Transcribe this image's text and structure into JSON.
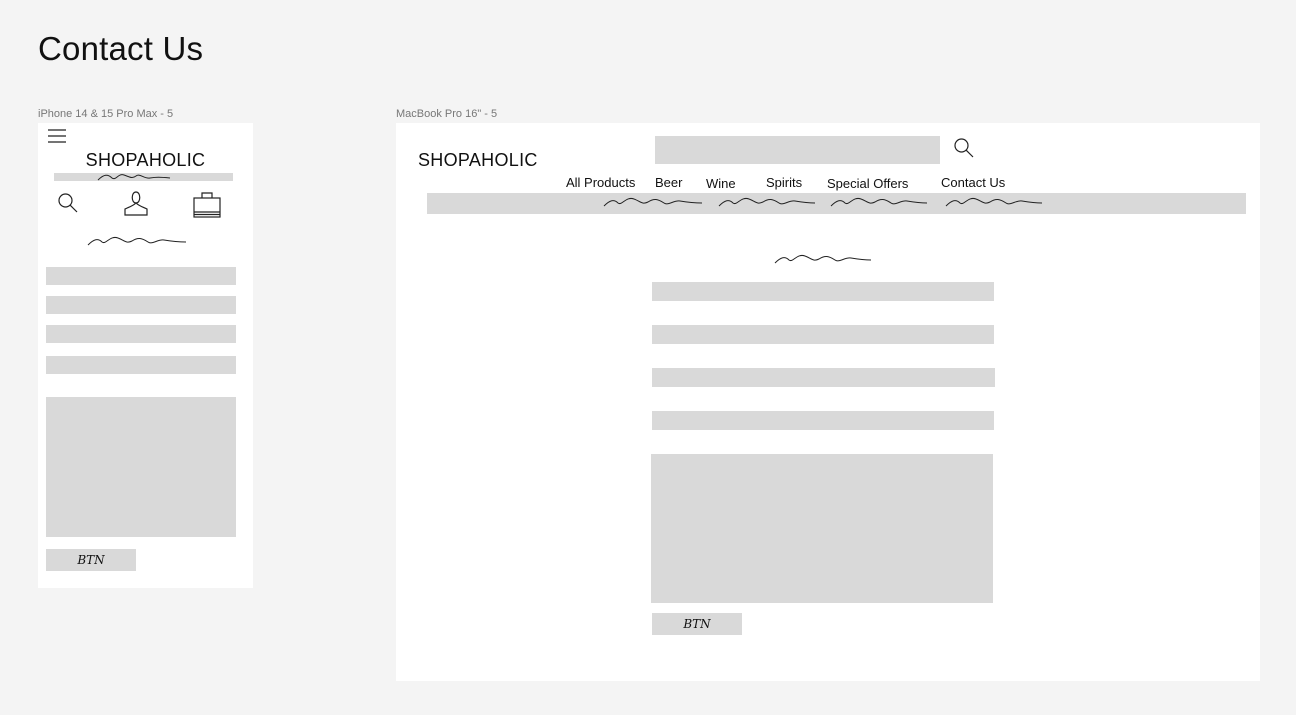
{
  "page": {
    "title": "Contact Us"
  },
  "mobile": {
    "frame_label": "iPhone 14 & 15 Pro Max - 5",
    "logo": "SHOPAHOLIC",
    "button_label": "BTN",
    "icons": [
      "hamburger-menu-icon",
      "search-icon",
      "user-icon",
      "shopping-bag-icon"
    ]
  },
  "desktop": {
    "frame_label": "MacBook Pro 16\" - 5",
    "logo": "SHOPAHOLIC",
    "nav": [
      {
        "label": "All Products"
      },
      {
        "label": "Beer"
      },
      {
        "label": "Wine"
      },
      {
        "label": "Spirits"
      },
      {
        "label": "Special Offers"
      },
      {
        "label": "Contact Us"
      }
    ],
    "button_label": "BTN",
    "icons": [
      "search-icon"
    ]
  },
  "colors": {
    "background": "#f4f4f4",
    "frame": "#ffffff",
    "placeholder": "#d9d9d9",
    "text": "#111111"
  }
}
